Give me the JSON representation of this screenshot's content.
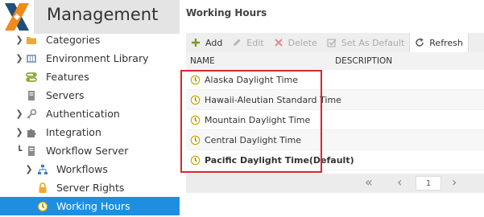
{
  "app": {
    "title": "Management"
  },
  "tree": {
    "items": [
      {
        "label": "Categories",
        "level": 1,
        "expandable": true,
        "icon": "folder-icon"
      },
      {
        "label": "Environment Library",
        "level": 1,
        "expandable": true,
        "icon": "library-icon"
      },
      {
        "label": "Features",
        "level": 1,
        "expandable": false,
        "icon": "features-icon"
      },
      {
        "label": "Servers",
        "level": 1,
        "expandable": false,
        "icon": "server-icon"
      },
      {
        "label": "Authentication",
        "level": 1,
        "expandable": true,
        "icon": "key-icon"
      },
      {
        "label": "Integration",
        "level": 1,
        "expandable": true,
        "icon": "puzzle-icon"
      },
      {
        "label": "Workflow Server",
        "level": 1,
        "expandable": true,
        "expanded": true,
        "icon": "server-icon"
      },
      {
        "label": "Workflows",
        "level": 2,
        "expandable": true,
        "icon": "workflow-icon"
      },
      {
        "label": "Server Rights",
        "level": 2,
        "expandable": false,
        "icon": "lock-icon"
      },
      {
        "label": "Working Hours",
        "level": 2,
        "expandable": false,
        "icon": "clock-icon",
        "selected": true
      }
    ]
  },
  "panel": {
    "title": "Working Hours"
  },
  "toolbar": {
    "add": "Add",
    "edit": "Edit",
    "delete": "Delete",
    "set_default": "Set As Default",
    "refresh": "Refresh"
  },
  "grid": {
    "columns": {
      "name": "NAME",
      "description": "DESCRIPTION"
    },
    "rows": [
      {
        "name": "Alaska Daylight Time",
        "description": ""
      },
      {
        "name": "Hawaii-Aleutian Standard Time",
        "description": ""
      },
      {
        "name": "Mountain Daylight Time",
        "description": ""
      },
      {
        "name": "Central Daylight Time",
        "description": ""
      },
      {
        "name": "Pacific Daylight Time(Default)",
        "description": "",
        "bold": true
      }
    ]
  },
  "pager": {
    "page": "1"
  },
  "colors": {
    "selected": "#1e8fe0",
    "highlight": "#d9262c",
    "accent": "#7a9a1e"
  }
}
